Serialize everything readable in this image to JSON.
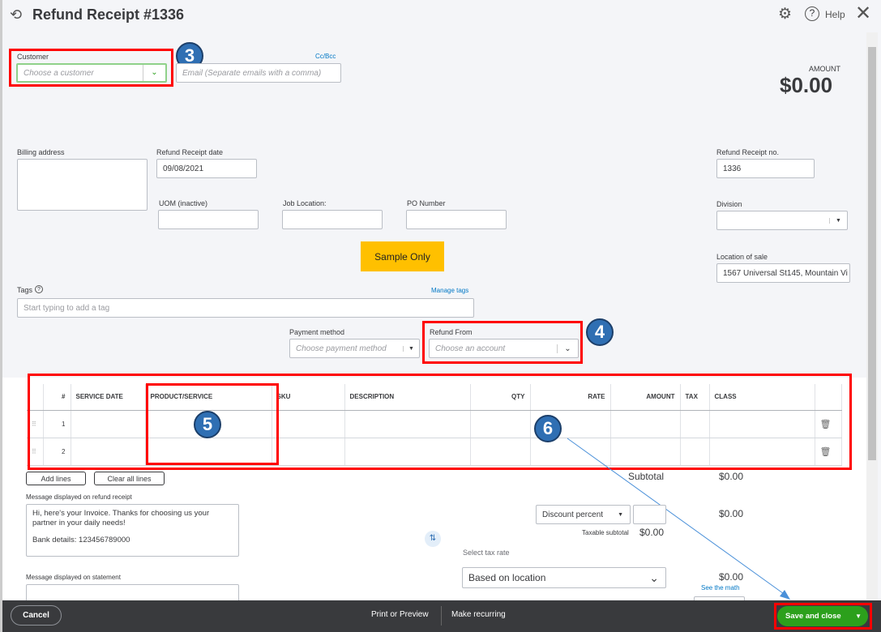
{
  "header": {
    "title": "Refund Receipt #1336",
    "help": "Help"
  },
  "customer": {
    "label": "Customer",
    "placeholder": "Choose a customer",
    "email_placeholder": "Email (Separate emails with a comma)",
    "cc_bcc": "Cc/Bcc"
  },
  "amount": {
    "label": "AMOUNT",
    "value": "$0.00"
  },
  "fields": {
    "billing_address": "Billing address",
    "receipt_date_label": "Refund Receipt date",
    "receipt_date": "09/08/2021",
    "uom": "UOM (inactive)",
    "job_location": "Job Location:",
    "po_number": "PO Number",
    "receipt_no_label": "Refund Receipt no.",
    "receipt_no": "1336",
    "division": "Division",
    "location_of_sale_label": "Location of sale",
    "location_of_sale": "1567 Universal St145, Mountain Vi",
    "sample": "Sample Only",
    "tags": "Tags",
    "tags_placeholder": "Start typing to add a tag",
    "manage_tags": "Manage tags",
    "payment_method": "Payment method",
    "payment_placeholder": "Choose payment method",
    "refund_from": "Refund From",
    "refund_placeholder": "Choose an account"
  },
  "annotations": [
    "3",
    "4",
    "5",
    "6"
  ],
  "table": {
    "columns": [
      "#",
      "SERVICE DATE",
      "PRODUCT/SERVICE",
      "SKU",
      "DESCRIPTION",
      "QTY",
      "RATE",
      "AMOUNT",
      "TAX",
      "CLASS"
    ],
    "rows": [
      "1",
      "2"
    ]
  },
  "buttons": {
    "add_lines": "Add lines",
    "clear_lines": "Clear all lines"
  },
  "messages": {
    "receipt_label": "Message displayed on refund receipt",
    "receipt_text1": "Hi, here's your Invoice. Thanks for choosing us your partner in your daily needs!",
    "receipt_text2": "Bank details: 123456789000",
    "statement_label": "Message displayed on statement"
  },
  "totals": {
    "subtotal_label": "Subtotal",
    "subtotal": "$0.00",
    "discount_type": "Discount percent",
    "discount": "$0.00",
    "taxable_label": "Taxable subtotal",
    "taxable": "$0.00",
    "tax_rate_label": "Select tax rate",
    "tax_rate": "Based on location",
    "tax": "$0.00",
    "see_math": "See the math"
  },
  "footer": {
    "cancel": "Cancel",
    "print": "Print or Preview",
    "recurring": "Make recurring",
    "save": "Save and close"
  }
}
